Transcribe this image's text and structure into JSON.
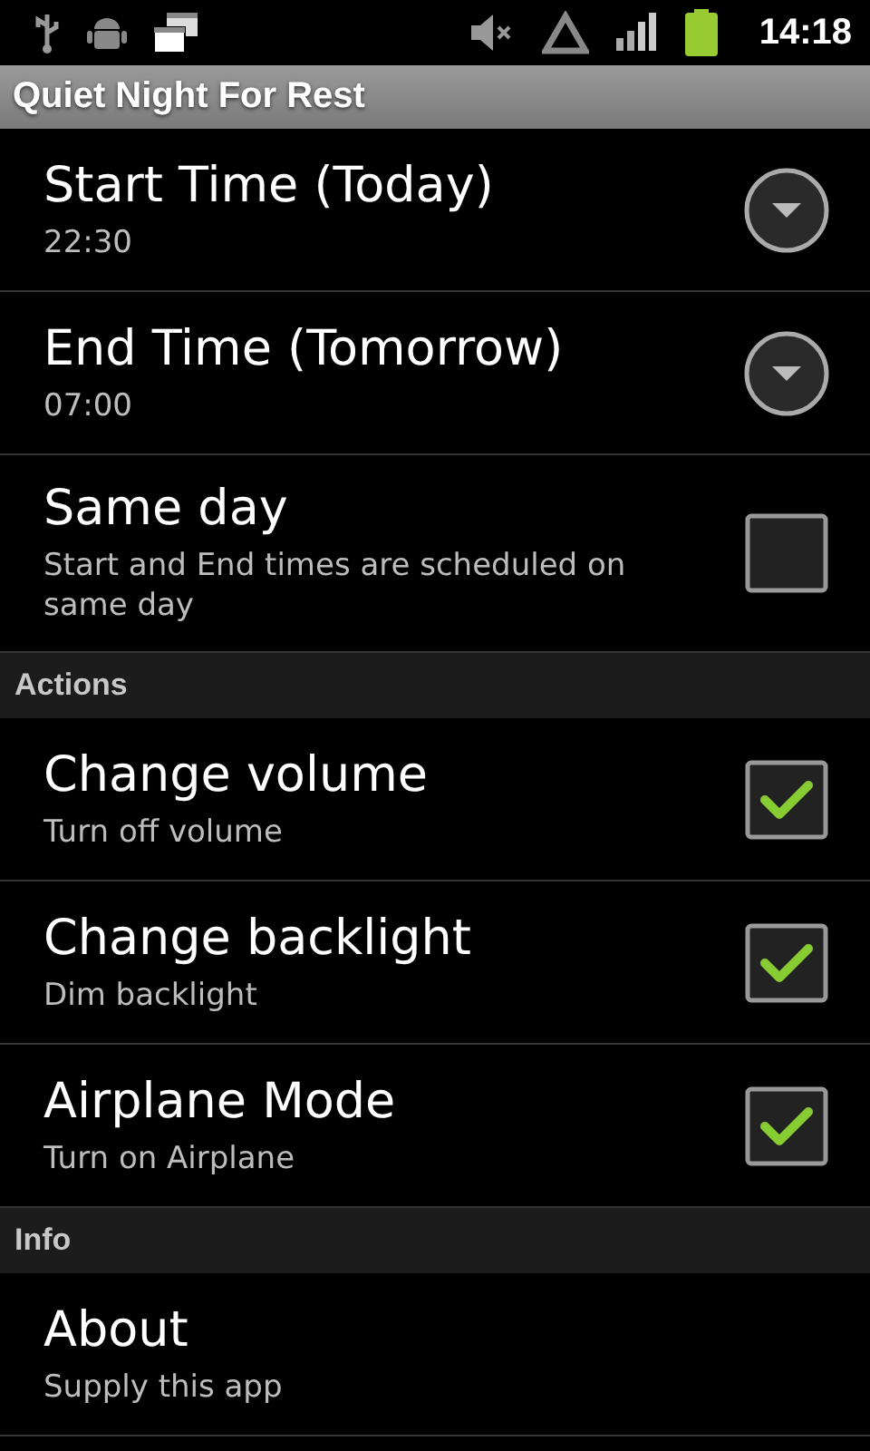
{
  "status_bar": {
    "time": "14:18"
  },
  "title": "Quiet Night For Rest",
  "items": [
    {
      "kind": "dropdown",
      "title": "Start Time (Today)",
      "summary": "22:30"
    },
    {
      "kind": "dropdown",
      "title": "End Time (Tomorrow)",
      "summary": "07:00"
    },
    {
      "kind": "checkbox",
      "title": "Same day",
      "summary": "Start and End times are scheduled on same day",
      "checked": false
    },
    {
      "kind": "header",
      "title": "Actions"
    },
    {
      "kind": "checkbox",
      "title": "Change volume",
      "summary": "Turn off volume",
      "checked": true
    },
    {
      "kind": "checkbox",
      "title": "Change backlight",
      "summary": "Dim backlight",
      "checked": true
    },
    {
      "kind": "checkbox",
      "title": "Airplane Mode",
      "summary": "Turn on Airplane",
      "checked": true
    },
    {
      "kind": "header",
      "title": "Info"
    },
    {
      "kind": "plain",
      "title": "About",
      "summary": "Supply this app"
    }
  ]
}
